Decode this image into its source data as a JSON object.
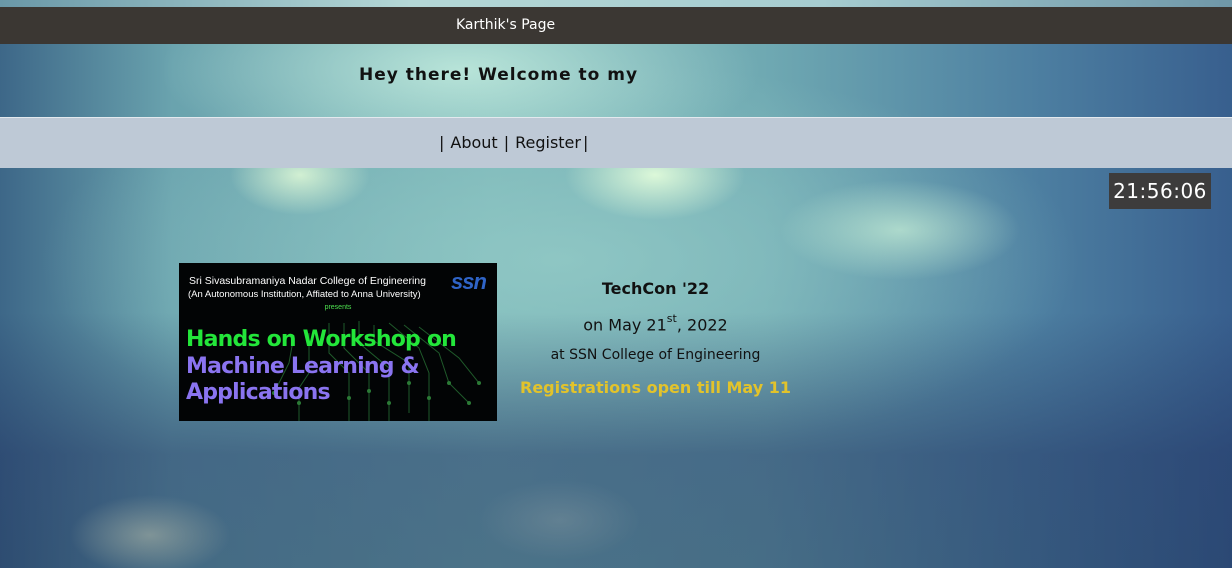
{
  "page": {
    "title": "Karthik's Page",
    "welcome": "Hey there! Welcome to my"
  },
  "nav": {
    "separator": "|",
    "items": [
      "About",
      "Register"
    ]
  },
  "clock": {
    "time": "21:56:06"
  },
  "banner": {
    "college": "Sri Sivasubramaniya Nadar College of Engineering",
    "affiliation": "(An Autonomous Institution, Affiated to Anna University)",
    "presents": "presents",
    "logo": "ssn",
    "headline_1": "Hands on Workshop on",
    "headline_2": "Machine Learning &",
    "headline_3": "Applications"
  },
  "event": {
    "name": "TechCon '22",
    "date_prefix": "on May 21",
    "date_suffix": "st",
    "date_year": ", 2022",
    "venue": "at SSN College of Engineering",
    "registration": "Registrations open till May 11"
  },
  "colors": {
    "title_bar": "#3b3733",
    "nav_bar": "#bec9d6",
    "clock_bg": "#3d3c3c",
    "registration_text": "#e2c32b",
    "banner_green": "#23e63a",
    "banner_purple": "#8a74f0",
    "banner_logo": "#2f64c7"
  }
}
